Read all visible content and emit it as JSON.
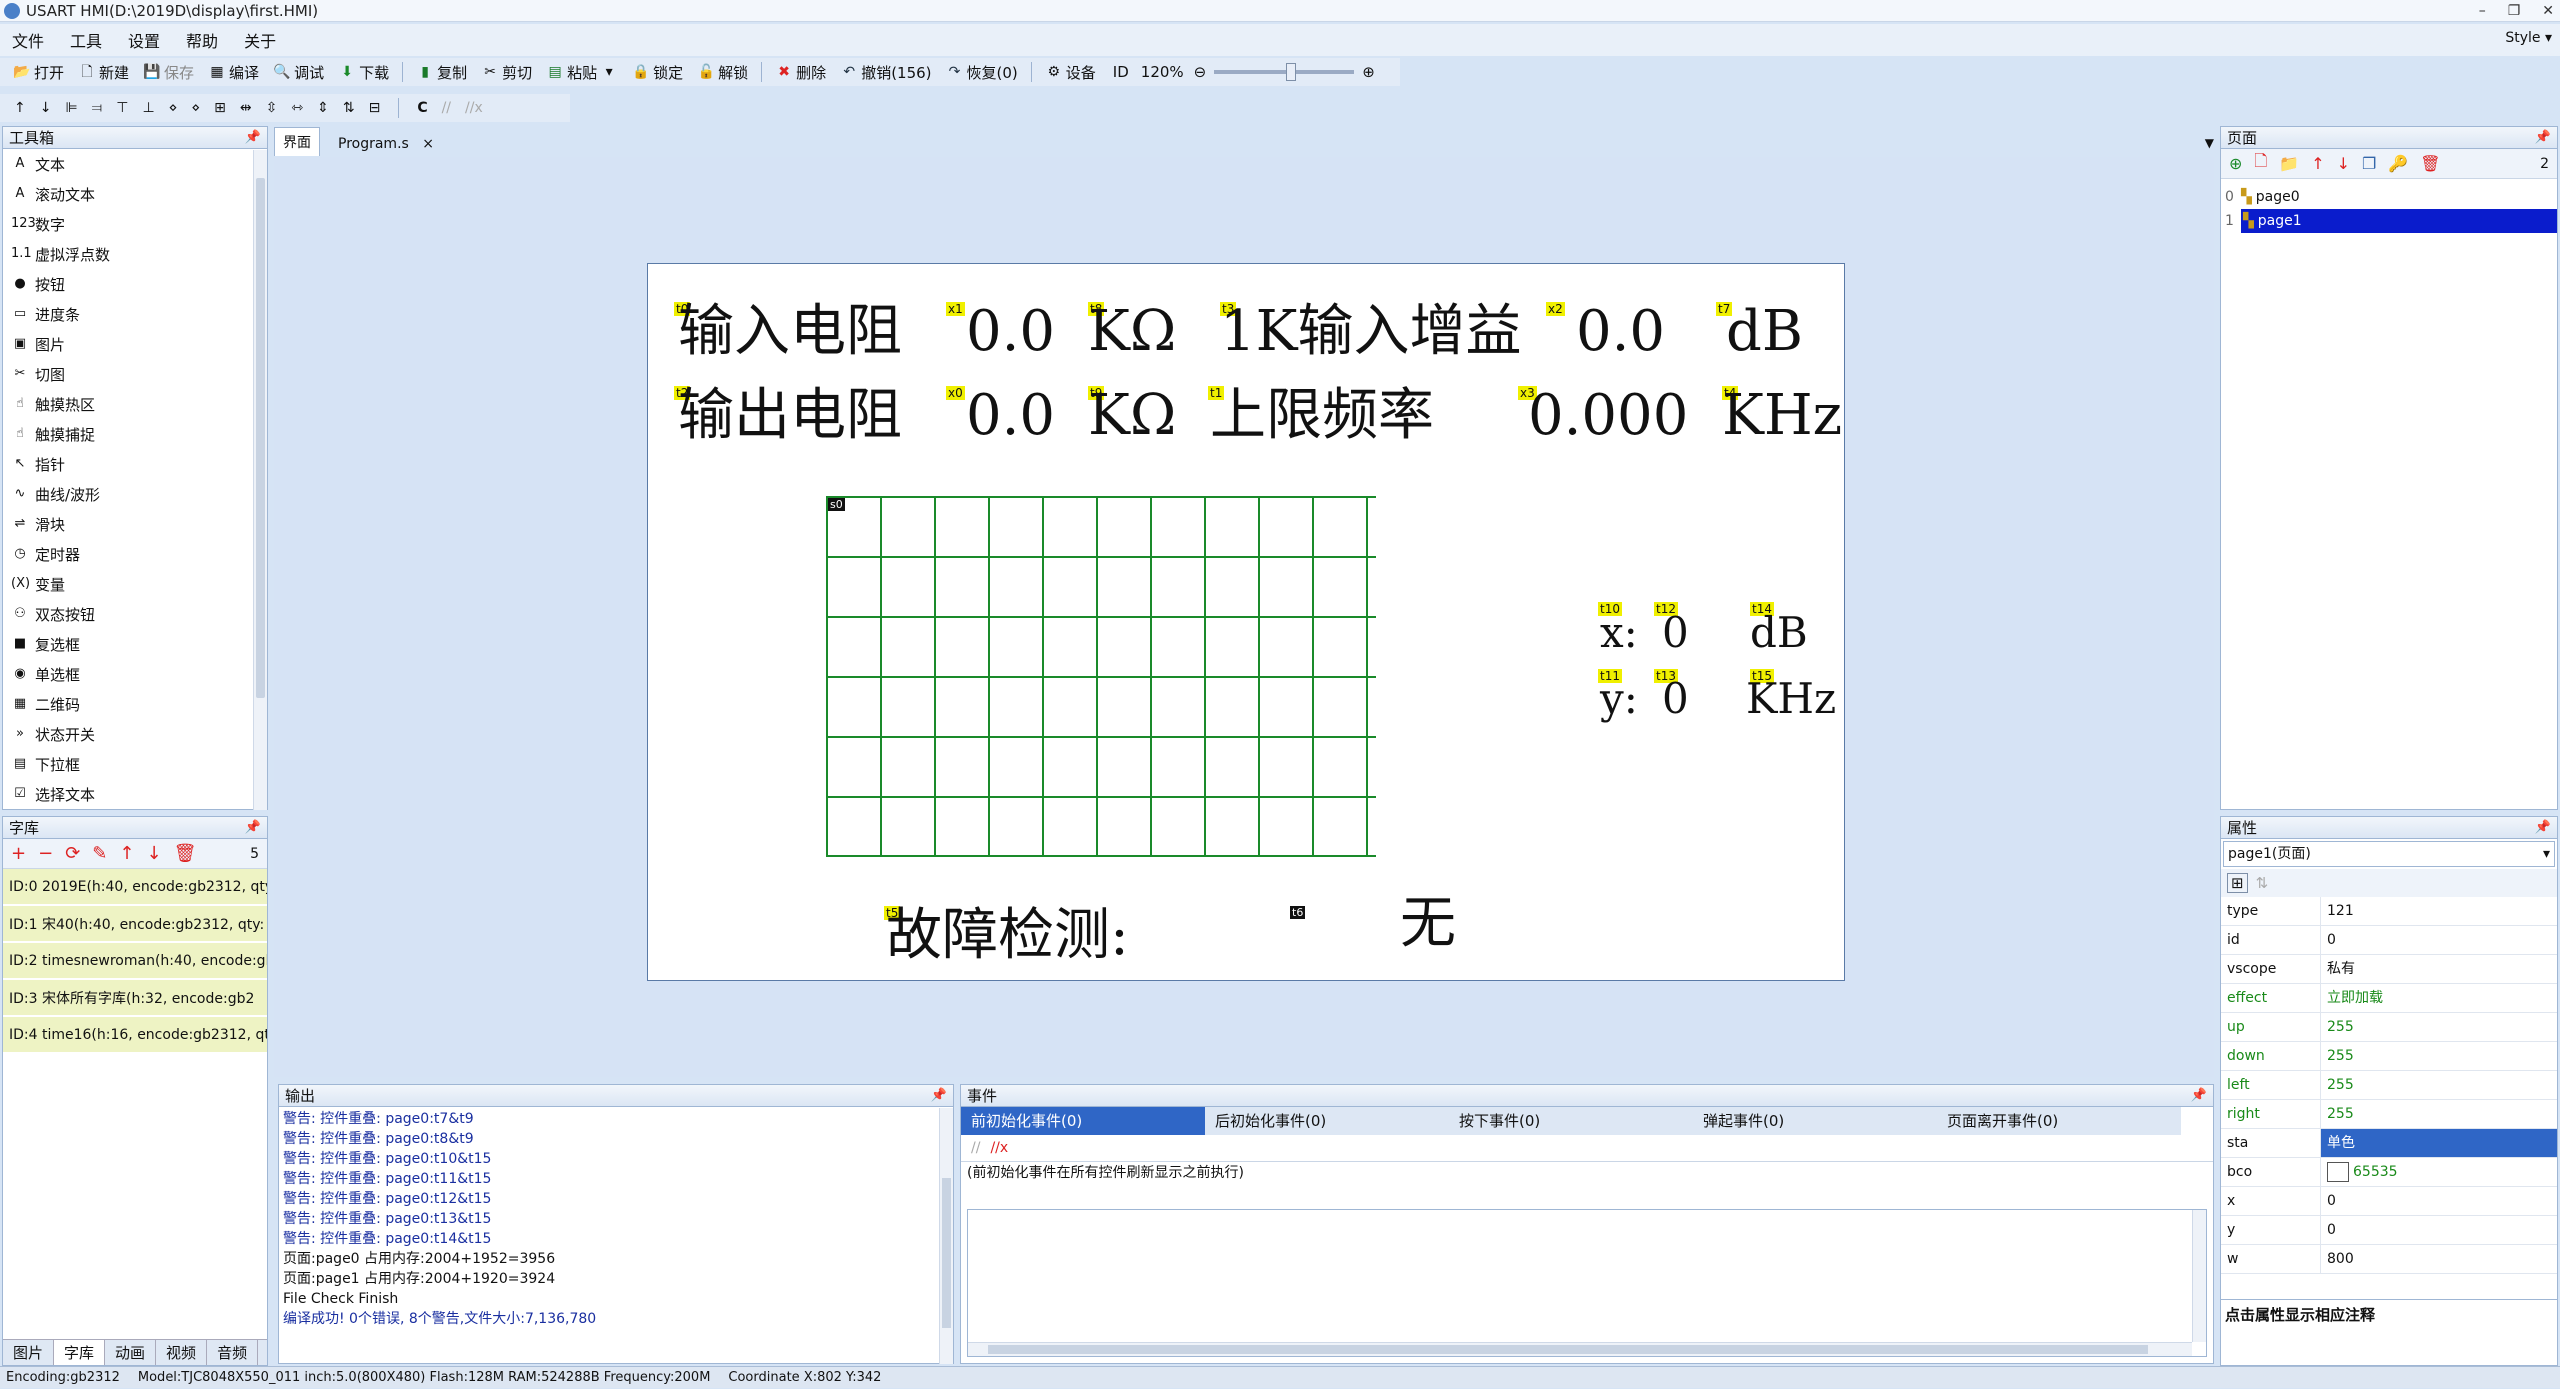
{
  "window": {
    "title": "USART HMI(D:\\2019D\\display\\first.HMI)",
    "min": "–",
    "max": "❐",
    "close": "✕"
  },
  "menu": {
    "items": [
      "文件",
      "工具",
      "设置",
      "帮助",
      "关于"
    ],
    "style": "Style ▾"
  },
  "toolbar": {
    "open": "打开",
    "new": "新建",
    "save": "保存",
    "compile": "编译",
    "debug": "调试",
    "download": "下载",
    "copy": "复制",
    "cut": "剪切",
    "paste": "粘贴",
    "lock": "锁定",
    "unlock": "解锁",
    "delete": "删除",
    "undo": "撤销(156)",
    "redo": "恢复(0)",
    "device": "设备",
    "id": "ID",
    "zoom": "120%"
  },
  "toolbox": {
    "title": "工具箱",
    "items": [
      "文本",
      "滚动文本",
      "数字",
      "虚拟浮点数",
      "按钮",
      "进度条",
      "图片",
      "切图",
      "触摸热区",
      "触摸捕捉",
      "指针",
      "曲线/波形",
      "滑块",
      "定时器",
      "变量",
      "双态按钮",
      "复选框",
      "单选框",
      "二维码",
      "状态开关",
      "下拉框",
      "选择文本"
    ],
    "icons": [
      "A",
      "A",
      "123",
      "1.1",
      "●",
      "▭",
      "▣",
      "✂",
      "☝",
      "☝",
      "↖",
      "∿",
      "⇌",
      "◷",
      "(X)",
      "⚇",
      "■",
      "◉",
      "▦",
      "»",
      "▤",
      "☑"
    ]
  },
  "fontlib": {
    "title": "字库",
    "count": "5",
    "rows": [
      "ID:0  2019E(h:40, encode:gb2312, qty",
      "ID:1  宋40(h:40, encode:gb2312, qty:",
      "ID:2  timesnewroman(h:40, encode:gb",
      "ID:3  宋体所有字库(h:32, encode:gb2",
      "ID:4  time16(h:16, encode:gb2312, qt"
    ],
    "tabs": [
      "图片",
      "字库",
      "动画",
      "视频",
      "音频"
    ]
  },
  "doc_tabs": {
    "tab1": "界面",
    "tab2": "Program.s",
    "close": "×"
  },
  "canvas": {
    "row1": {
      "t0_tag": "t0",
      "label1": "输入电阻",
      "x1_tag": "x1",
      "val1": "0.0",
      "t8_tag": "t8",
      "unit1": "KΩ",
      "t3_tag": "t3",
      "label2": "1K输入增益",
      "x2_tag": "x2",
      "val2": "0.0",
      "t7_tag": "t7",
      "unit2": "dB"
    },
    "row2": {
      "t2_tag": "t2",
      "label1": "输出电阻",
      "x0_tag": "x0",
      "val1": "0.0",
      "t9_tag": "t9",
      "unit1": "KΩ",
      "t1_tag": "t1",
      "label2": "上限频率",
      "x3_tag": "x3",
      "val2": "0.000",
      "t4_tag": "t4",
      "unit2": "KHz"
    },
    "grid_tag": "s0",
    "cursor": {
      "t10": "t10",
      "t12": "t12",
      "t14": "t14",
      "x_label": "x:",
      "x_val": "0",
      "x_unit": "dB",
      "t11": "t11",
      "t13": "t13",
      "t15": "t15",
      "y_label": "y:",
      "y_val": "0",
      "y_unit": "KHz"
    },
    "fault": {
      "t5_tag": "t5",
      "label": "故障检测:",
      "t6_tag": "t6",
      "value": "无"
    }
  },
  "pages": {
    "title": "页面",
    "count": "2",
    "items": [
      {
        "idx": "0",
        "name": "page0"
      },
      {
        "idx": "1",
        "name": "page1"
      }
    ]
  },
  "output": {
    "title": "输出",
    "lines": [
      "警告: 控件重叠: page0:t7&t9",
      "警告: 控件重叠: page0:t8&t9",
      "警告: 控件重叠: page0:t10&t15",
      "警告: 控件重叠: page0:t11&t15",
      "警告: 控件重叠: page0:t12&t15",
      "警告: 控件重叠: page0:t13&t15",
      "警告: 控件重叠: page0:t14&t15",
      "页面:page0 占用内存:2004+1952=3956",
      "页面:page1 占用内存:2004+1920=3924",
      "File Check Finish",
      "编译成功! 0个错误, 8个警告,文件大小:7,136,780"
    ]
  },
  "events": {
    "title": "事件",
    "tabs": [
      "前初始化事件(0)",
      "后初始化事件(0)",
      "按下事件(0)",
      "弹起事件(0)",
      "页面离开事件(0)"
    ],
    "note": "(前初始化事件在所有控件刷新显示之前执行)"
  },
  "props": {
    "title": "属性",
    "selector": "page1(页面)",
    "rows": [
      {
        "k": "type",
        "v": "121"
      },
      {
        "k": "id",
        "v": "0"
      },
      {
        "k": "vscope",
        "v": "私有"
      },
      {
        "k": "effect",
        "v": "立即加载"
      },
      {
        "k": "up",
        "v": "255"
      },
      {
        "k": "down",
        "v": "255"
      },
      {
        "k": "left",
        "v": "255"
      },
      {
        "k": "right",
        "v": "255"
      },
      {
        "k": "sta",
        "v": "单色"
      },
      {
        "k": "bco",
        "v": "65535"
      },
      {
        "k": "x",
        "v": "0"
      },
      {
        "k": "y",
        "v": "0"
      },
      {
        "k": "w",
        "v": "800"
      }
    ],
    "hint": "点击属性显示相应注释"
  },
  "status": {
    "encoding": "Encoding:gb2312",
    "model": "Model:TJC8048X550_011  inch:5.0(800X480) Flash:128M RAM:524288B Frequency:200M",
    "coord": "Coordinate X:802  Y:342"
  }
}
